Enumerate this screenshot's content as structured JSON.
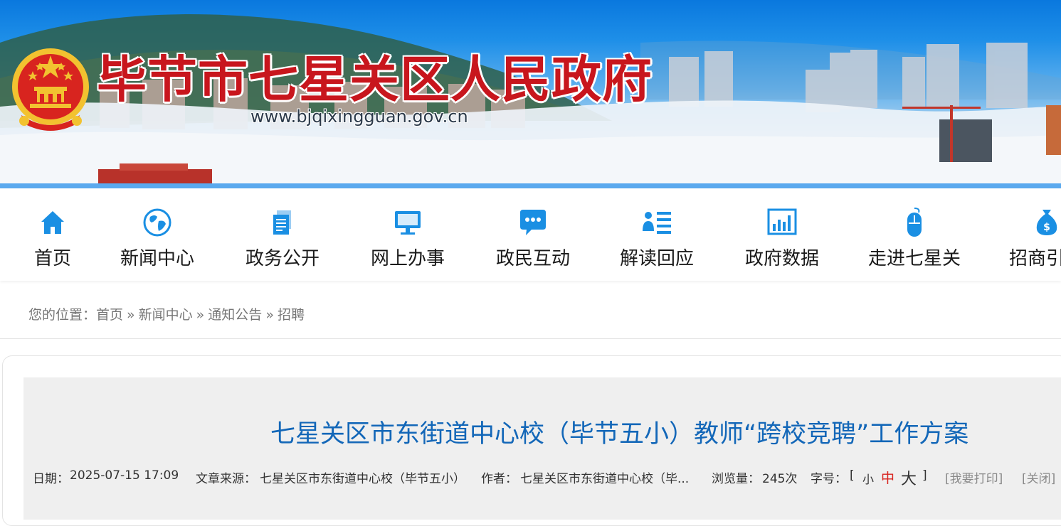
{
  "header": {
    "site_title": "毕节市七星关区人民政府",
    "site_url": "www.bjqixingguan.gov.cn",
    "title_color": "#c8161d",
    "banner_color": "#1e8fe8"
  },
  "nav": {
    "items": [
      {
        "label": "首页",
        "icon": "home-icon"
      },
      {
        "label": "新闻中心",
        "icon": "globe-icon"
      },
      {
        "label": "政务公开",
        "icon": "document-icon"
      },
      {
        "label": "网上办事",
        "icon": "monitor-icon"
      },
      {
        "label": "政民互动",
        "icon": "chat-icon"
      },
      {
        "label": "解读回应",
        "icon": "user-list-icon"
      },
      {
        "label": "政府数据",
        "icon": "bar-chart-icon"
      },
      {
        "label": "走进七星关",
        "icon": "mouse-icon"
      },
      {
        "label": "招商引",
        "icon": "money-bag-icon"
      }
    ],
    "icon_color": "#1a8fe3"
  },
  "breadcrumb": {
    "prefix": "您的位置：",
    "items": [
      "首页",
      "新闻中心",
      "通知公告",
      "招聘"
    ],
    "separator": "»"
  },
  "article": {
    "title": "七星关区市东街道中心校（毕节五小）教师“跨校竞聘”工作方案",
    "title_color": "#1367b8",
    "meta": {
      "date_label": "日期：",
      "date": "2025-07-15 17:09",
      "source_label": "文章来源：",
      "source": "七星关区市东街道中心校（毕节五小）",
      "author_label": "作者：",
      "author": "七星关区市东街道中心校（毕...",
      "views_label": "浏览量：",
      "views": "245次",
      "font_label": "字号：",
      "bracket_open": "[",
      "size_small": "小",
      "size_medium": "中",
      "size_large": "大",
      "bracket_close": "]",
      "print": "[我要打印]",
      "close": "[关闭]"
    }
  }
}
